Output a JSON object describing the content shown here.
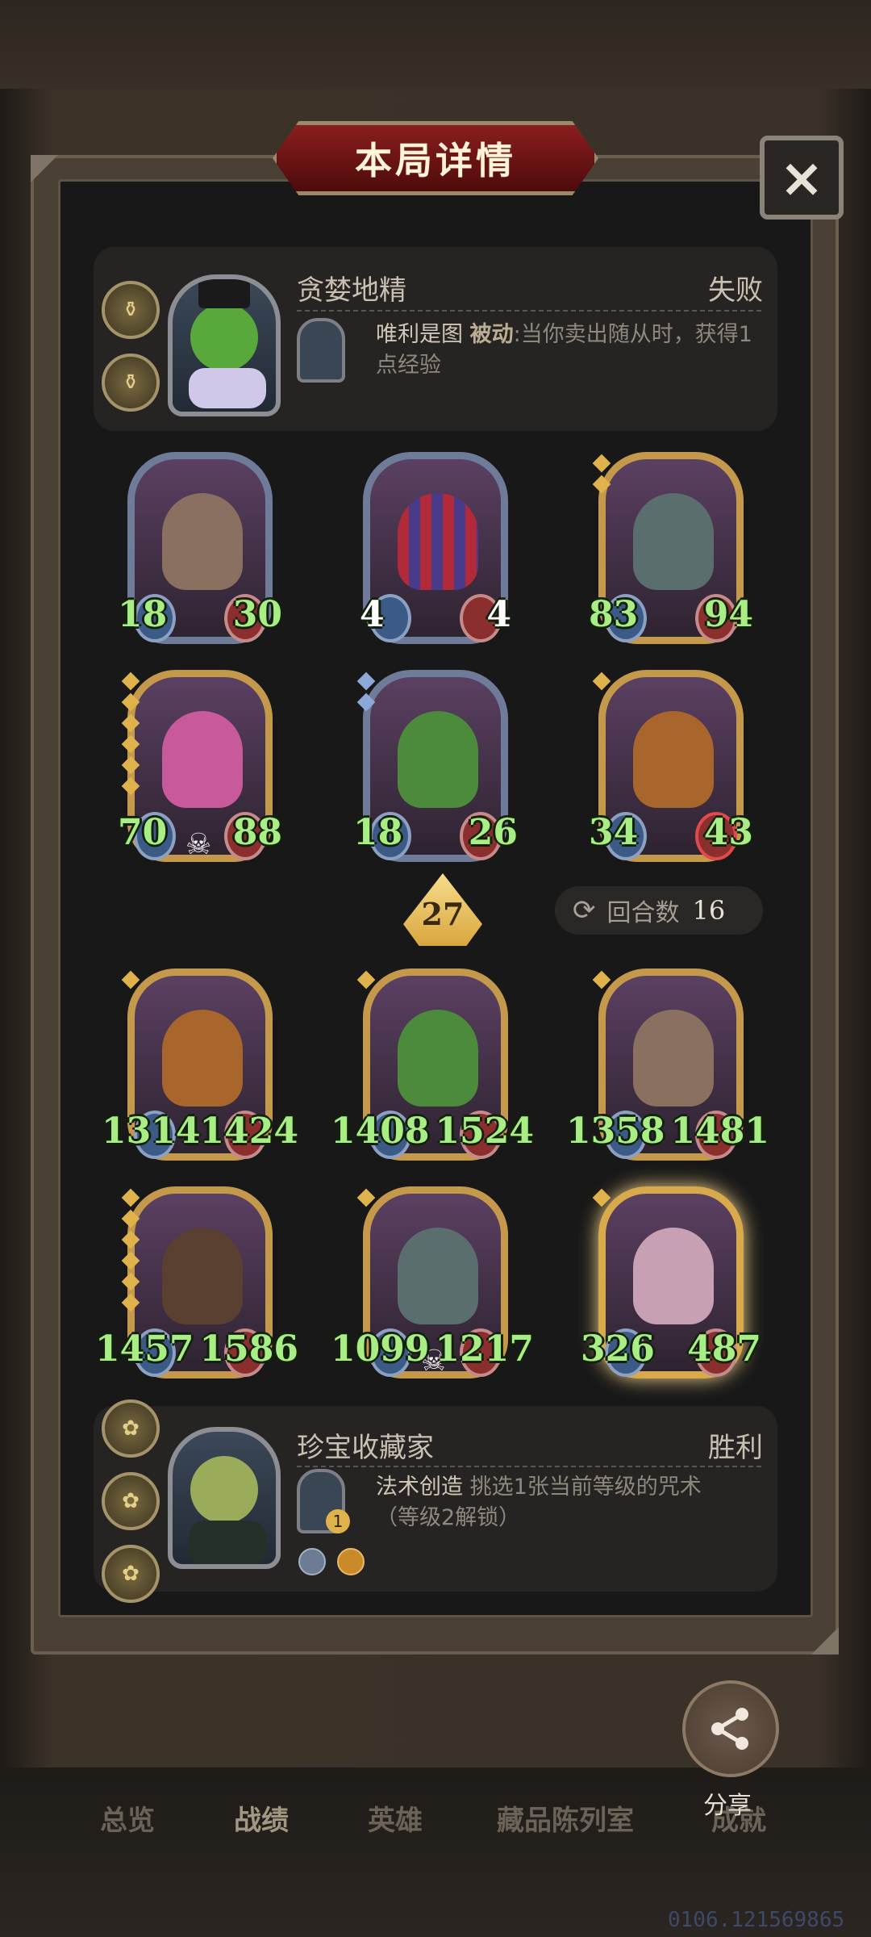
{
  "title": "本局详情",
  "close_icon": "×",
  "opponent": {
    "name": "贪婪地精",
    "result": "失败",
    "power_name": "唯利是图",
    "power_keyword": "被动",
    "power_desc": ":当你卖出随从时，获得1点经验",
    "coins": [
      "coin-icon",
      "coin-icon"
    ]
  },
  "player": {
    "name": "珍宝收藏家",
    "result": "胜利",
    "power_name": "法术创造",
    "power_desc": "挑选1张当前等级的咒术（等级2解锁）",
    "power_cost": "1"
  },
  "opponent_board": [
    {
      "attack": "18",
      "health": "30"
    },
    {
      "attack": "4",
      "health": "4"
    },
    {
      "attack": "83",
      "health": "94"
    },
    {
      "attack": "70",
      "health": "88"
    },
    {
      "attack": "18",
      "health": "26"
    },
    {
      "attack": "34",
      "health": "43"
    }
  ],
  "player_board": [
    {
      "attack": "1314",
      "health": "1424"
    },
    {
      "attack": "1408",
      "health": "1524"
    },
    {
      "attack": "1358",
      "health": "1481"
    },
    {
      "attack": "1457",
      "health": "1586"
    },
    {
      "attack": "1099",
      "health": "1217"
    },
    {
      "attack": "326",
      "health": "487"
    }
  ],
  "tier": "27",
  "turn": {
    "label": "回合数",
    "value": "16"
  },
  "nav": [
    "总览",
    "战绩",
    "英雄",
    "藏品陈列室",
    "成就"
  ],
  "share_label": "分享",
  "version": "0106.121569865",
  "colors": {
    "stat_green": "#a8ee84",
    "gold_frame": "#c5994c",
    "banner_red": "#8a1e1e"
  }
}
